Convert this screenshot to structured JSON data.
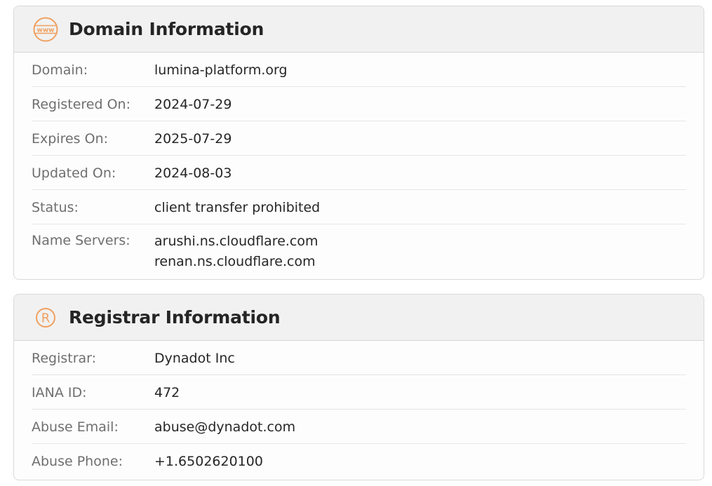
{
  "domain_section": {
    "title": "Domain Information",
    "icon": "www-globe-icon",
    "rows": [
      {
        "label": "Domain:",
        "value": "lumina-platform.org"
      },
      {
        "label": "Registered On:",
        "value": "2024-07-29"
      },
      {
        "label": "Expires On:",
        "value": "2025-07-29"
      },
      {
        "label": "Updated On:",
        "value": "2024-08-03"
      },
      {
        "label": "Status:",
        "value": "client transfer prohibited"
      }
    ],
    "name_servers": {
      "label": "Name Servers:",
      "values": [
        "arushi.ns.cloudflare.com",
        "renan.ns.cloudflare.com"
      ]
    }
  },
  "registrar_section": {
    "title": "Registrar Information",
    "icon": "registered-icon",
    "rows": [
      {
        "label": "Registrar:",
        "value": "Dynadot Inc"
      },
      {
        "label": "IANA ID:",
        "value": "472"
      },
      {
        "label": "Abuse Email:",
        "value": "abuse@dynadot.com"
      },
      {
        "label": "Abuse Phone:",
        "value": "+1.6502620100"
      }
    ]
  },
  "colors": {
    "accent": "#f0a060",
    "header_bg": "#f1f1f1",
    "label": "#6f6f6f"
  }
}
